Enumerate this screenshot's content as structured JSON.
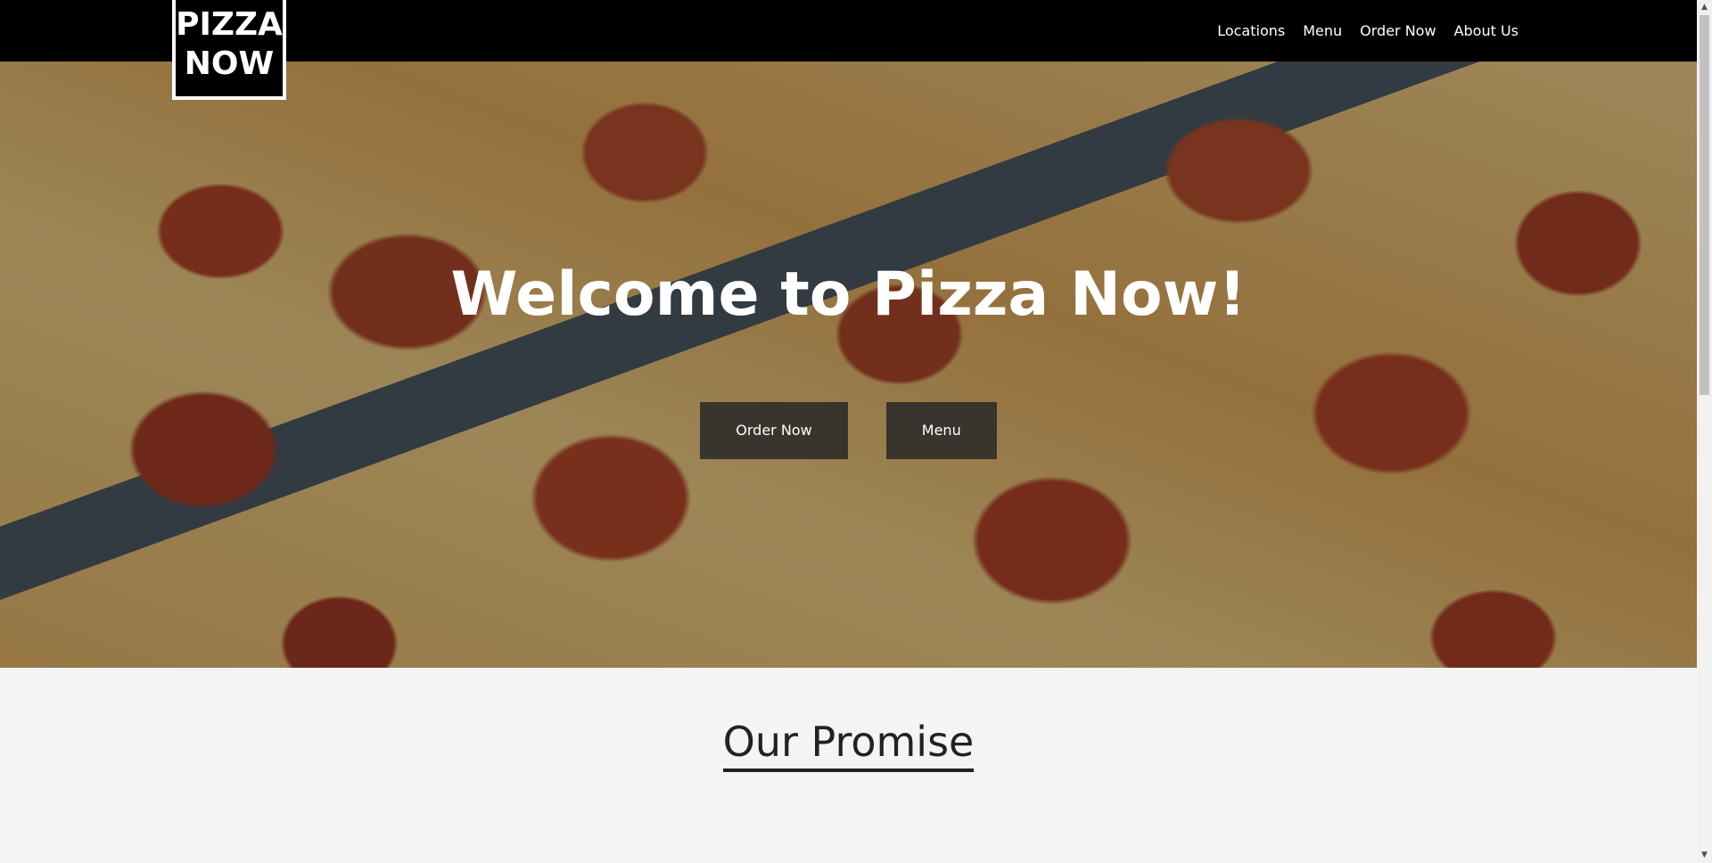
{
  "navbar": {
    "logo_line1": "PIZZA",
    "logo_line2": "NOW",
    "links": [
      "Locations",
      "Menu",
      "Order Now",
      "About Us"
    ]
  },
  "hero": {
    "title": "Welcome to Pizza Now!",
    "buttons": [
      "Order Now",
      "Menu"
    ]
  },
  "promise": {
    "title": "Our Promise"
  },
  "scrollbar": {
    "up_icon": "triangle-up",
    "down_icon": "triangle-down"
  }
}
